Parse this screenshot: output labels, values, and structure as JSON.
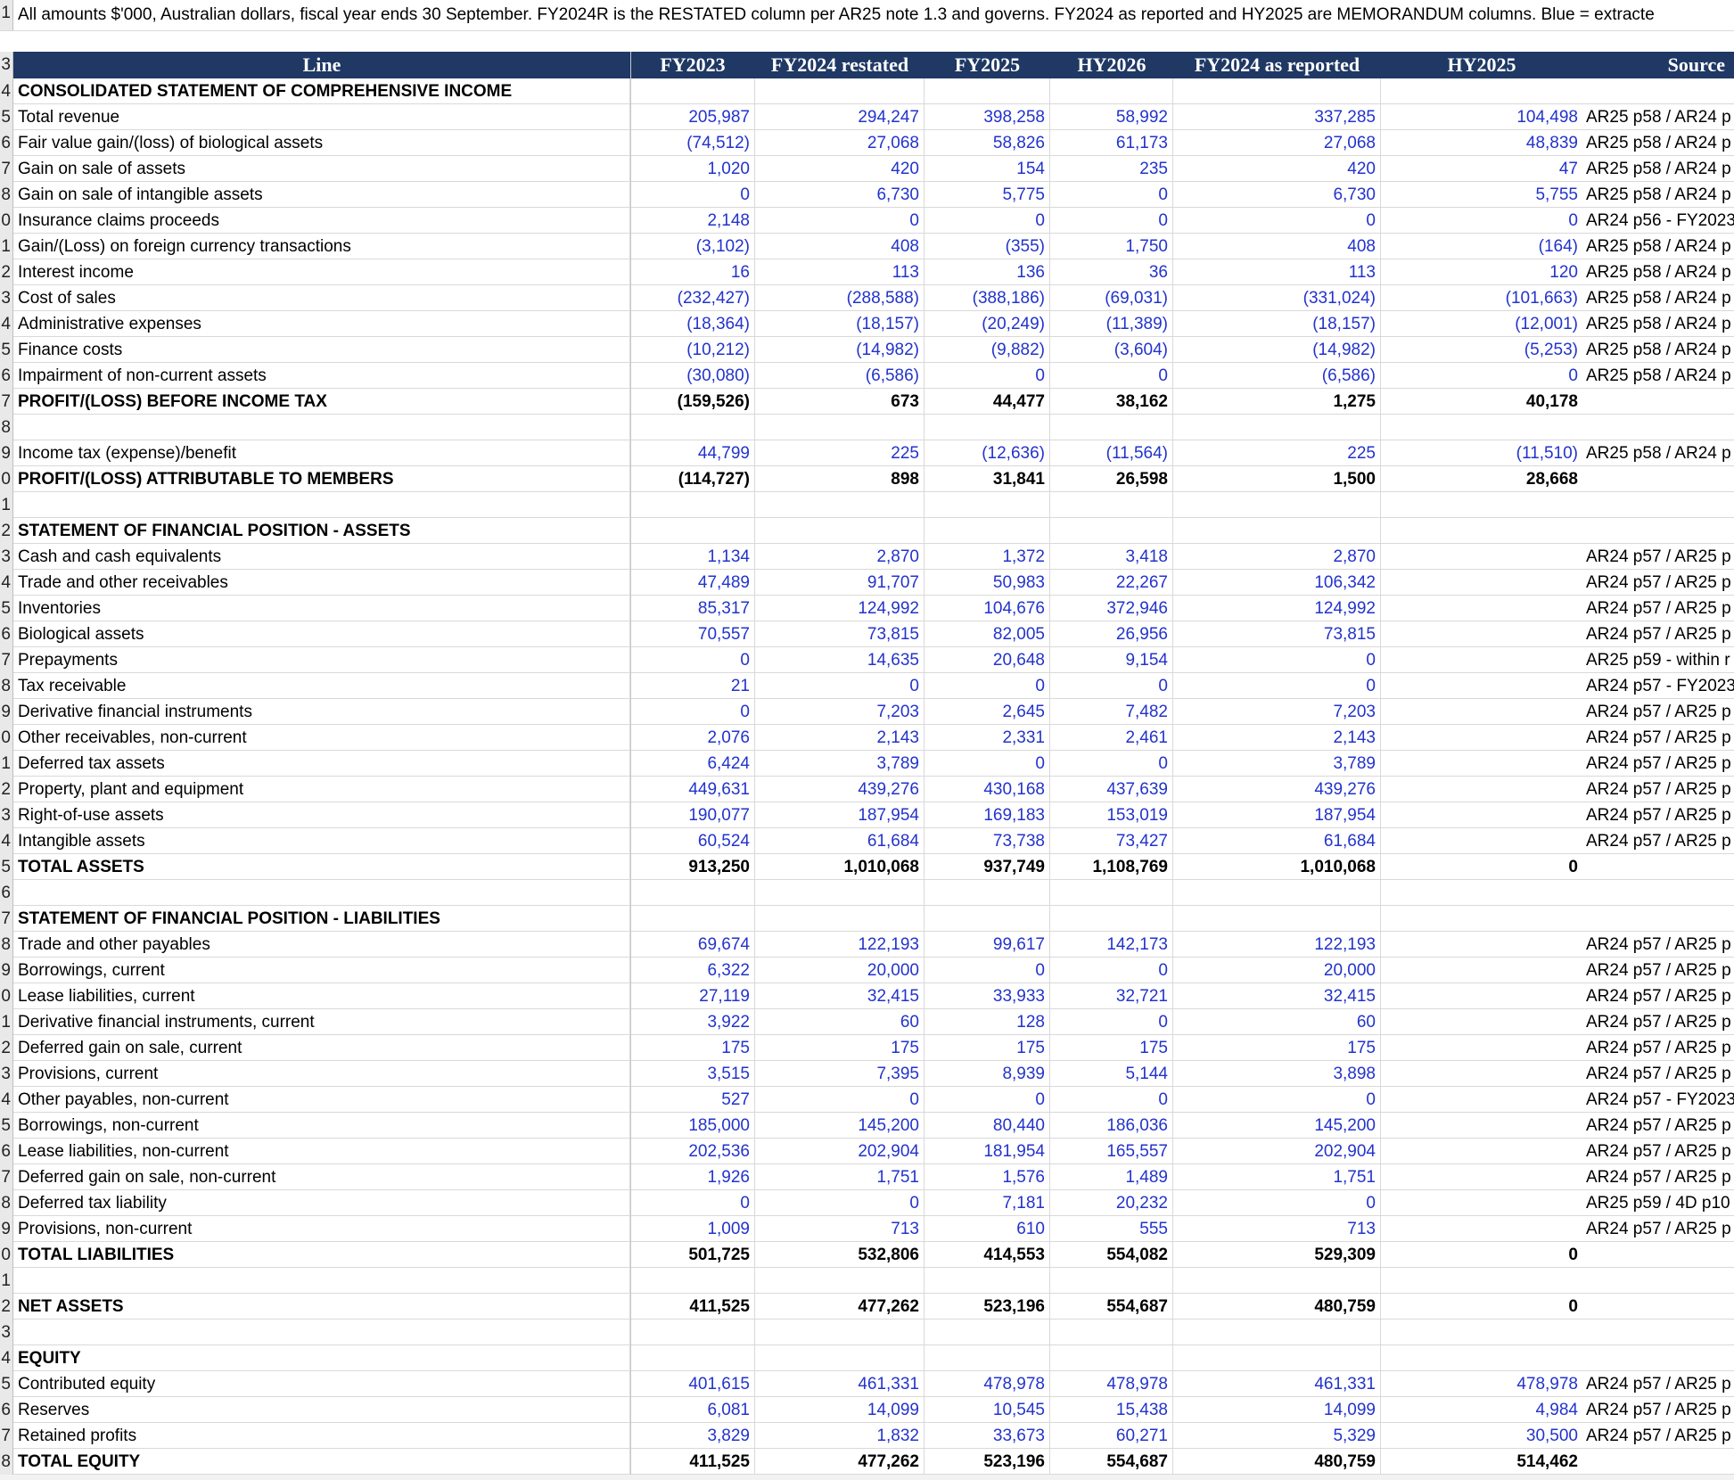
{
  "note": "All amounts $'000, Australian dollars, fiscal year ends 30 September. FY2024R is the RESTATED column per AR25 note 1.3 and governs. FY2024 as reported and HY2025 are MEMORANDUM columns. Blue = extracte",
  "header": {
    "line": "Line",
    "fy2023": "FY2023",
    "fy2024r": "FY2024 restated",
    "fy2025": "FY2025",
    "hy2026": "HY2026",
    "fy2024ar": "FY2024 as reported",
    "hy2025": "HY2025",
    "source": "Source"
  },
  "rows": [
    {
      "rn": "4",
      "label": "CONSOLIDATED STATEMENT OF COMPREHENSIVE INCOME",
      "bold": true,
      "v": [
        "",
        "",
        "",
        "",
        "",
        ""
      ],
      "src": ""
    },
    {
      "rn": "5",
      "label": "Total revenue",
      "v": [
        "205,987",
        "294,247",
        "398,258",
        "58,992",
        "337,285",
        "104,498"
      ],
      "src": "AR25 p58 / AR24 p"
    },
    {
      "rn": "6",
      "label": "Fair value gain/(loss) of biological assets",
      "v": [
        "(74,512)",
        "27,068",
        "58,826",
        "61,173",
        "27,068",
        "48,839"
      ],
      "src": "AR25 p58 / AR24 p"
    },
    {
      "rn": "7",
      "label": "Gain on sale of assets",
      "v": [
        "1,020",
        "420",
        "154",
        "235",
        "420",
        "47"
      ],
      "src": "AR25 p58 / AR24 p"
    },
    {
      "rn": "8",
      "label": "Gain on sale of intangible assets",
      "v": [
        "0",
        "6,730",
        "5,775",
        "0",
        "6,730",
        "5,755"
      ],
      "src": "AR25 p58 / AR24 p"
    },
    {
      "rn": "0",
      "label": "Insurance claims proceeds",
      "v": [
        "2,148",
        "0",
        "0",
        "0",
        "0",
        "0"
      ],
      "src": "AR24 p56 - FY2023"
    },
    {
      "rn": "1",
      "label": "Gain/(Loss) on foreign currency transactions",
      "v": [
        "(3,102)",
        "408",
        "(355)",
        "1,750",
        "408",
        "(164)"
      ],
      "src": "AR25 p58 / AR24 p"
    },
    {
      "rn": "2",
      "label": "Interest income",
      "v": [
        "16",
        "113",
        "136",
        "36",
        "113",
        "120"
      ],
      "src": "AR25 p58 / AR24 p"
    },
    {
      "rn": "3",
      "label": "Cost of sales",
      "v": [
        "(232,427)",
        "(288,588)",
        "(388,186)",
        "(69,031)",
        "(331,024)",
        "(101,663)"
      ],
      "src": "AR25 p58 / AR24 p"
    },
    {
      "rn": "4",
      "label": "Administrative expenses",
      "v": [
        "(18,364)",
        "(18,157)",
        "(20,249)",
        "(11,389)",
        "(18,157)",
        "(12,001)"
      ],
      "src": "AR25 p58 / AR24 p"
    },
    {
      "rn": "5",
      "label": "Finance costs",
      "v": [
        "(10,212)",
        "(14,982)",
        "(9,882)",
        "(3,604)",
        "(14,982)",
        "(5,253)"
      ],
      "src": "AR25 p58 / AR24 p"
    },
    {
      "rn": "6",
      "label": "Impairment of non-current assets",
      "v": [
        "(30,080)",
        "(6,586)",
        "0",
        "0",
        "(6,586)",
        "0"
      ],
      "src": "AR25 p58 / AR24 p"
    },
    {
      "rn": "7",
      "label": "PROFIT/(LOSS) BEFORE INCOME TAX",
      "bold": true,
      "total": true,
      "v": [
        "(159,526)",
        "673",
        "44,477",
        "38,162",
        "1,275",
        "40,178"
      ],
      "src": ""
    },
    {
      "rn": "8",
      "label": "",
      "v": [
        "",
        "",
        "",
        "",
        "",
        ""
      ],
      "src": ""
    },
    {
      "rn": "9",
      "label": "Income tax (expense)/benefit",
      "v": [
        "44,799",
        "225",
        "(12,636)",
        "(11,564)",
        "225",
        "(11,510)"
      ],
      "src": "AR25 p58 / AR24 p"
    },
    {
      "rn": "0",
      "label": "PROFIT/(LOSS) ATTRIBUTABLE TO MEMBERS",
      "bold": true,
      "total": true,
      "v": [
        "(114,727)",
        "898",
        "31,841",
        "26,598",
        "1,500",
        "28,668"
      ],
      "src": ""
    },
    {
      "rn": "1",
      "label": "",
      "v": [
        "",
        "",
        "",
        "",
        "",
        ""
      ],
      "src": ""
    },
    {
      "rn": "2",
      "label": "STATEMENT OF FINANCIAL POSITION - ASSETS",
      "bold": true,
      "v": [
        "",
        "",
        "",
        "",
        "",
        ""
      ],
      "src": ""
    },
    {
      "rn": "3",
      "label": "Cash and cash equivalents",
      "v": [
        "1,134",
        "2,870",
        "1,372",
        "3,418",
        "2,870",
        ""
      ],
      "src": "AR24 p57 / AR25 p"
    },
    {
      "rn": "4",
      "label": "Trade and other receivables",
      "v": [
        "47,489",
        "91,707",
        "50,983",
        "22,267",
        "106,342",
        ""
      ],
      "src": "AR24 p57 / AR25 p"
    },
    {
      "rn": "5",
      "label": "Inventories",
      "v": [
        "85,317",
        "124,992",
        "104,676",
        "372,946",
        "124,992",
        ""
      ],
      "src": "AR24 p57 / AR25 p"
    },
    {
      "rn": "6",
      "label": "Biological assets",
      "v": [
        "70,557",
        "73,815",
        "82,005",
        "26,956",
        "73,815",
        ""
      ],
      "src": "AR24 p57 / AR25 p"
    },
    {
      "rn": "7",
      "label": "Prepayments",
      "v": [
        "0",
        "14,635",
        "20,648",
        "9,154",
        "0",
        ""
      ],
      "src": "AR25 p59 - within r"
    },
    {
      "rn": "8",
      "label": "Tax receivable",
      "v": [
        "21",
        "0",
        "0",
        "0",
        "0",
        ""
      ],
      "src": "AR24 p57 - FY2023"
    },
    {
      "rn": "9",
      "label": "Derivative financial instruments",
      "v": [
        "0",
        "7,203",
        "2,645",
        "7,482",
        "7,203",
        ""
      ],
      "src": "AR24 p57 / AR25 p"
    },
    {
      "rn": "0",
      "label": "Other receivables, non-current",
      "v": [
        "2,076",
        "2,143",
        "2,331",
        "2,461",
        "2,143",
        ""
      ],
      "src": "AR24 p57 / AR25 p"
    },
    {
      "rn": "1",
      "label": "Deferred tax assets",
      "v": [
        "6,424",
        "3,789",
        "0",
        "0",
        "3,789",
        ""
      ],
      "src": "AR24 p57 / AR25 p"
    },
    {
      "rn": "2",
      "label": "Property, plant and equipment",
      "v": [
        "449,631",
        "439,276",
        "430,168",
        "437,639",
        "439,276",
        ""
      ],
      "src": "AR24 p57 / AR25 p"
    },
    {
      "rn": "3",
      "label": "Right-of-use assets",
      "v": [
        "190,077",
        "187,954",
        "169,183",
        "153,019",
        "187,954",
        ""
      ],
      "src": "AR24 p57 / AR25 p"
    },
    {
      "rn": "4",
      "label": "Intangible assets",
      "v": [
        "60,524",
        "61,684",
        "73,738",
        "73,427",
        "61,684",
        ""
      ],
      "src": "AR24 p57 / AR25 p"
    },
    {
      "rn": "5",
      "label": "TOTAL ASSETS",
      "bold": true,
      "total": true,
      "v": [
        "913,250",
        "1,010,068",
        "937,749",
        "1,108,769",
        "1,010,068",
        "0"
      ],
      "src": ""
    },
    {
      "rn": "6",
      "label": "",
      "v": [
        "",
        "",
        "",
        "",
        "",
        ""
      ],
      "src": ""
    },
    {
      "rn": "7",
      "label": "STATEMENT OF FINANCIAL POSITION - LIABILITIES",
      "bold": true,
      "v": [
        "",
        "",
        "",
        "",
        "",
        ""
      ],
      "src": ""
    },
    {
      "rn": "8",
      "label": "Trade and other payables",
      "v": [
        "69,674",
        "122,193",
        "99,617",
        "142,173",
        "122,193",
        ""
      ],
      "src": "AR24 p57 / AR25 p"
    },
    {
      "rn": "9",
      "label": "Borrowings, current",
      "v": [
        "6,322",
        "20,000",
        "0",
        "0",
        "20,000",
        ""
      ],
      "src": "AR24 p57 / AR25 p"
    },
    {
      "rn": "0",
      "label": "Lease liabilities, current",
      "v": [
        "27,119",
        "32,415",
        "33,933",
        "32,721",
        "32,415",
        ""
      ],
      "src": "AR24 p57 / AR25 p"
    },
    {
      "rn": "1",
      "label": "Derivative financial instruments, current",
      "v": [
        "3,922",
        "60",
        "128",
        "0",
        "60",
        ""
      ],
      "src": "AR24 p57 / AR25 p"
    },
    {
      "rn": "2",
      "label": "Deferred gain on sale, current",
      "v": [
        "175",
        "175",
        "175",
        "175",
        "175",
        ""
      ],
      "src": "AR24 p57 / AR25 p"
    },
    {
      "rn": "3",
      "label": "Provisions, current",
      "v": [
        "3,515",
        "7,395",
        "8,939",
        "5,144",
        "3,898",
        ""
      ],
      "src": "AR24 p57 / AR25 p"
    },
    {
      "rn": "4",
      "label": "Other payables, non-current",
      "v": [
        "527",
        "0",
        "0",
        "0",
        "0",
        ""
      ],
      "src": "AR24 p57 - FY2023"
    },
    {
      "rn": "5",
      "label": "Borrowings, non-current",
      "v": [
        "185,000",
        "145,200",
        "80,440",
        "186,036",
        "145,200",
        ""
      ],
      "src": "AR24 p57 / AR25 p"
    },
    {
      "rn": "6",
      "label": "Lease liabilities, non-current",
      "v": [
        "202,536",
        "202,904",
        "181,954",
        "165,557",
        "202,904",
        ""
      ],
      "src": "AR24 p57 / AR25 p"
    },
    {
      "rn": "7",
      "label": "Deferred gain on sale, non-current",
      "v": [
        "1,926",
        "1,751",
        "1,576",
        "1,489",
        "1,751",
        ""
      ],
      "src": "AR24 p57 / AR25 p"
    },
    {
      "rn": "8",
      "label": "Deferred tax liability",
      "v": [
        "0",
        "0",
        "7,181",
        "20,232",
        "0",
        ""
      ],
      "src": "AR25 p59 / 4D p10"
    },
    {
      "rn": "9",
      "label": "Provisions, non-current",
      "v": [
        "1,009",
        "713",
        "610",
        "555",
        "713",
        ""
      ],
      "src": "AR24 p57 / AR25 p"
    },
    {
      "rn": "0",
      "label": "TOTAL LIABILITIES",
      "bold": true,
      "total": true,
      "v": [
        "501,725",
        "532,806",
        "414,553",
        "554,082",
        "529,309",
        "0"
      ],
      "src": ""
    },
    {
      "rn": "1",
      "label": "",
      "v": [
        "",
        "",
        "",
        "",
        "",
        ""
      ],
      "src": ""
    },
    {
      "rn": "2",
      "label": "NET ASSETS",
      "bold": true,
      "total": true,
      "v": [
        "411,525",
        "477,262",
        "523,196",
        "554,687",
        "480,759",
        "0"
      ],
      "src": ""
    },
    {
      "rn": "3",
      "label": "",
      "v": [
        "",
        "",
        "",
        "",
        "",
        ""
      ],
      "src": ""
    },
    {
      "rn": "4",
      "label": "EQUITY",
      "bold": true,
      "v": [
        "",
        "",
        "",
        "",
        "",
        ""
      ],
      "src": ""
    },
    {
      "rn": "5",
      "label": "Contributed equity",
      "v": [
        "401,615",
        "461,331",
        "478,978",
        "478,978",
        "461,331",
        "478,978"
      ],
      "src": "AR24 p57 / AR25 p"
    },
    {
      "rn": "6",
      "label": "Reserves",
      "v": [
        "6,081",
        "14,099",
        "10,545",
        "15,438",
        "14,099",
        "4,984"
      ],
      "src": "AR24 p57 / AR25 p"
    },
    {
      "rn": "7",
      "label": "Retained profits",
      "v": [
        "3,829",
        "1,832",
        "33,673",
        "60,271",
        "5,329",
        "30,500"
      ],
      "src": "AR24 p57 / AR25 p"
    },
    {
      "rn": "8",
      "label": "TOTAL EQUITY",
      "bold": true,
      "total": true,
      "v": [
        "411,525",
        "477,262",
        "523,196",
        "554,687",
        "480,759",
        "514,462"
      ],
      "src": ""
    }
  ],
  "colors": {
    "header_bg": "#1f3864",
    "input_blue": "#2233cc"
  }
}
